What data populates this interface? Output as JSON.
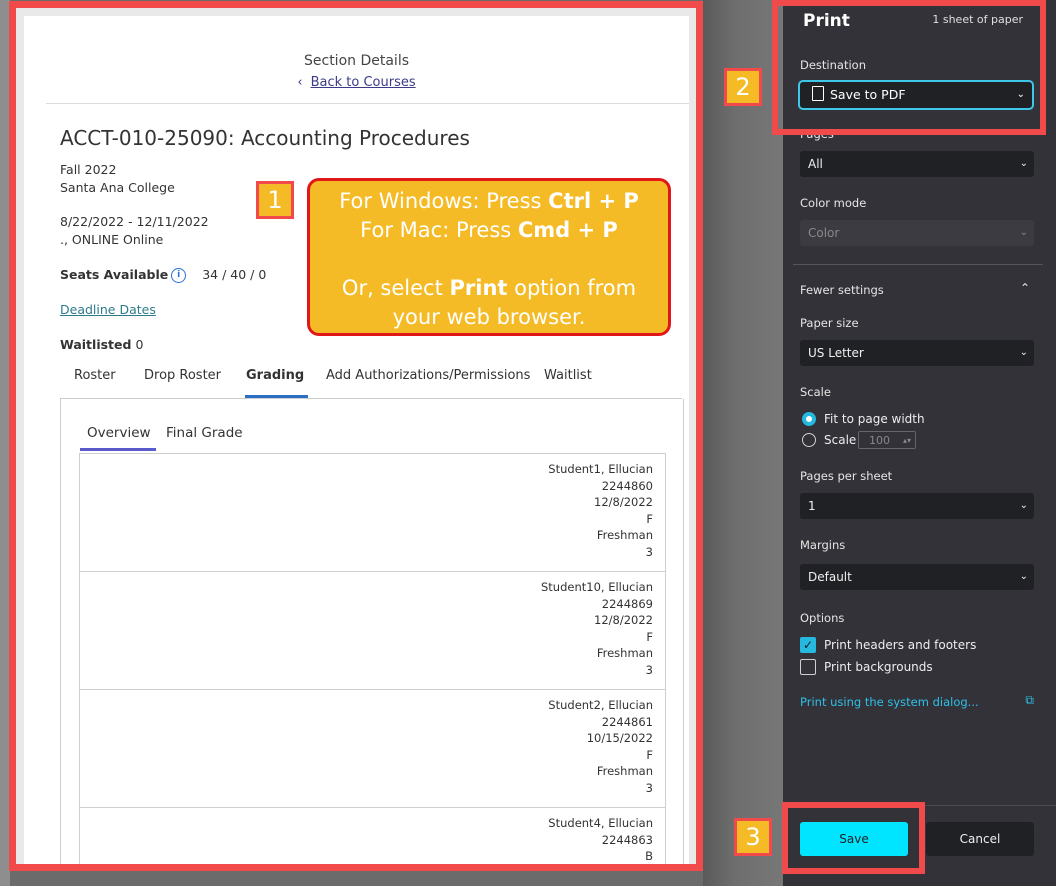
{
  "preview": {
    "section_title": "Section Details",
    "back_link": "Back to Courses",
    "course_title": "ACCT-010-25090: Accounting Procedures",
    "term": "Fall 2022",
    "college": "Santa Ana College",
    "dates": "8/22/2022 - 12/11/2022",
    "location": "., ONLINE Online",
    "seats_label": "Seats Available",
    "seats_value": "34 / 40 / 0",
    "deadline_link": "Deadline Dates",
    "waitlisted_label": "Waitlisted",
    "waitlisted_value": "0",
    "tabs": [
      "Roster",
      "Drop Roster",
      "Grading",
      "Add Authorizations/Permissions",
      "Waitlist"
    ],
    "active_tab": "Grading",
    "subtabs": [
      "Overview",
      "Final Grade"
    ],
    "students": [
      {
        "name": "Student1, Ellucian",
        "id": "2244860",
        "date": "12/8/2022",
        "grade": "F",
        "level": "Freshman",
        "units": "3"
      },
      {
        "name": "Student10, Ellucian",
        "id": "2244869",
        "date": "12/8/2022",
        "grade": "F",
        "level": "Freshman",
        "units": "3"
      },
      {
        "name": "Student2, Ellucian",
        "id": "2244861",
        "date": "10/15/2022",
        "grade": "F",
        "level": "Freshman",
        "units": "3"
      },
      {
        "name": "Student4, Ellucian",
        "id": "2244863",
        "date": "",
        "grade": "B",
        "level": "",
        "units": ""
      }
    ]
  },
  "callouts": {
    "one": "1",
    "two": "2",
    "three": "3",
    "windows_prefix": "For Windows:  Press ",
    "windows_keys": "Ctrl + P",
    "mac_prefix": "For Mac:  Press ",
    "mac_keys": "Cmd + P",
    "or_prefix": "Or, select ",
    "or_bold": "Print",
    "or_suffix": " option from",
    "or_line2": "your web browser."
  },
  "print": {
    "title": "Print",
    "sheets": "1 sheet of paper",
    "destination_label": "Destination",
    "destination_value": "Save to PDF",
    "pages_label": "Pages",
    "pages_value": "All",
    "color_label": "Color mode",
    "color_value": "Color",
    "fewer_settings": "Fewer settings",
    "paper_label": "Paper size",
    "paper_value": "US Letter",
    "scale_label": "Scale",
    "fit_label": "Fit to page width",
    "scale_option": "Scale",
    "scale_value": "100",
    "pps_label": "Pages per sheet",
    "pps_value": "1",
    "margins_label": "Margins",
    "margins_value": "Default",
    "options_label": "Options",
    "headers_footers": "Print headers and footers",
    "backgrounds": "Print backgrounds",
    "system_dialog": "Print using the system dialog...",
    "save": "Save",
    "cancel": "Cancel"
  }
}
